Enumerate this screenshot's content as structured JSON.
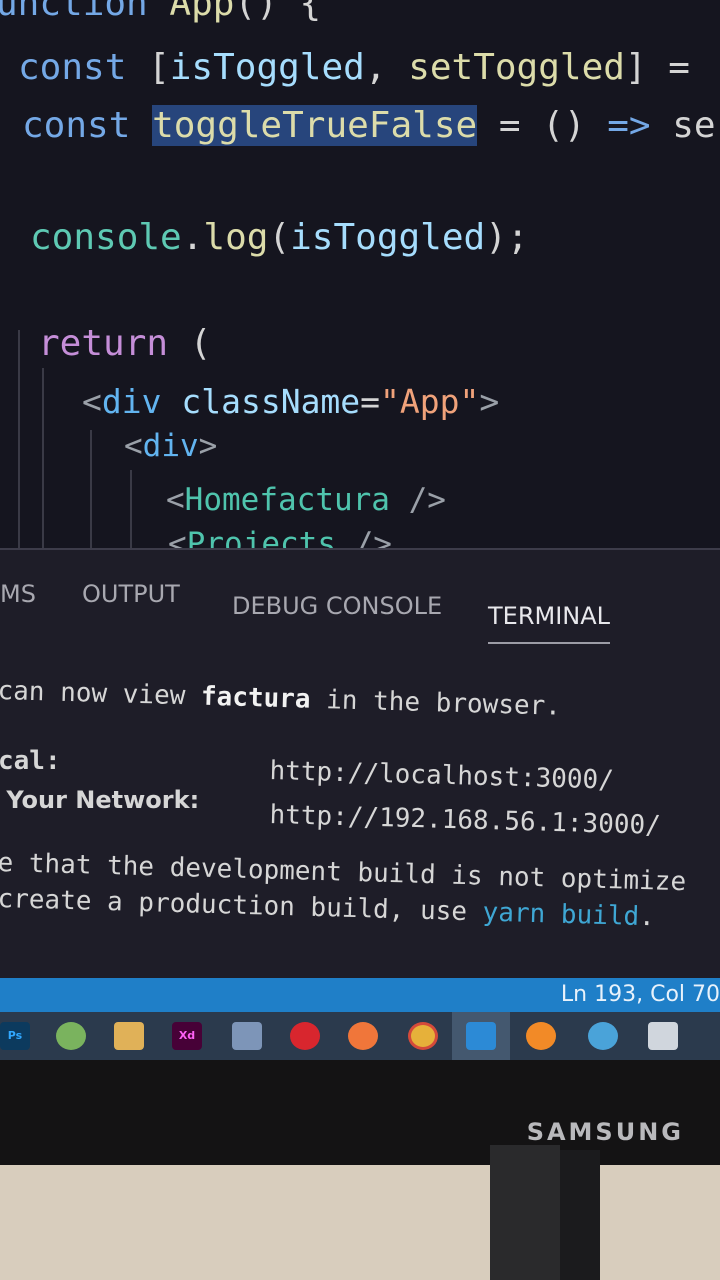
{
  "editor": {
    "lines": {
      "l0": {
        "kw": "unction",
        "fn": "App",
        "rest": "() {"
      },
      "l1": {
        "kw": "const",
        "open": "[",
        "a": "isToggled",
        "comma": ", ",
        "b": "setToggled",
        "close": "] ="
      },
      "l2": {
        "kw": "const",
        "name": "toggleTrueFalse",
        "rest": " = () ",
        "arrow": "=>",
        "tail": " se"
      },
      "l3": {
        "obj": "console",
        "dot": ".",
        "fn": "log",
        "open": "(",
        "arg": "isToggled",
        "close": ");"
      },
      "l4": {
        "kw": "return",
        "rest": " ("
      },
      "l5": {
        "lt": "<",
        "tag": "div",
        "attr": "className",
        "eq": "=",
        "str": "\"App\"",
        "gt": ">"
      },
      "l6": {
        "lt": "<",
        "tag": "div",
        "gt": ">"
      },
      "l7": {
        "lt": "<",
        "comp": "Homefactura",
        "end": " />"
      },
      "l8": {
        "lt": "<",
        "comp": "Projects",
        "end": " />"
      }
    }
  },
  "panel": {
    "tabs": [
      "MS",
      "OUTPUT",
      "DEBUG CONSOLE",
      "TERMINAL"
    ],
    "active_tab": "TERMINAL",
    "terminal": {
      "line1_pre": "can now view ",
      "line1_app": "factura",
      "line1_post": " in the browser.",
      "local_label": "cal:",
      "local_url": "http://localhost:3000/",
      "network_label": " Your Network:",
      "network_url": "http://192.168.56.1:3000/",
      "note1": "e that the development build is not optimize",
      "note2_pre": "create a production build, use ",
      "note2_cmd": "yarn build",
      "note2_post": "."
    }
  },
  "statusbar": {
    "position": "Ln 193, Col 70"
  },
  "taskbar": {
    "icons": [
      "photoshop-icon",
      "messaging-icon",
      "folder-icon",
      "xd-icon",
      "app-icon",
      "opera-icon",
      "app-icon-orange",
      "chrome-icon",
      "vscode-icon",
      "firefox-icon",
      "app-icon-red",
      "files-icon"
    ],
    "labels": {
      "ps": "Ps",
      "xd": "Xd"
    }
  },
  "monitor": {
    "brand": "SAMSUNG"
  }
}
